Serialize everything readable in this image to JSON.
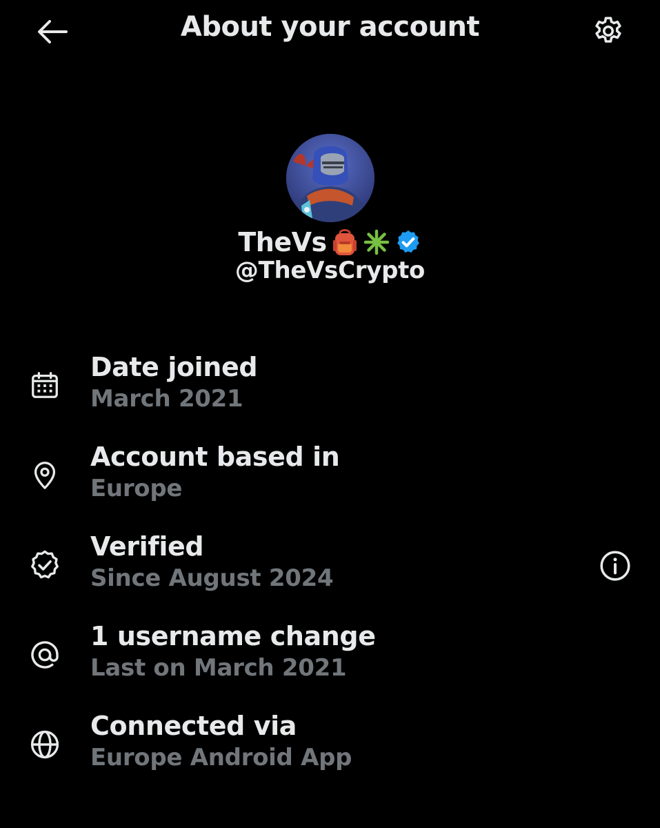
{
  "header": {
    "title": "About your account",
    "back_icon": "arrow-left-icon",
    "settings_icon": "gear-icon"
  },
  "profile": {
    "display_name": "TheVs",
    "name_emojis": [
      "🎒",
      "✳️"
    ],
    "verified_badge_color": "#1d9bf0",
    "handle": "@TheVsCrypto"
  },
  "info": [
    {
      "icon": "calendar-icon",
      "title": "Date joined",
      "subtitle": "March 2021"
    },
    {
      "icon": "location-pin-icon",
      "title": "Account based in",
      "subtitle": "Europe"
    },
    {
      "icon": "verified-badge-icon",
      "title": "Verified",
      "subtitle": "Since August 2024",
      "action_icon": "info-icon"
    },
    {
      "icon": "at-sign-icon",
      "title": "1 username change",
      "subtitle": "Last on March 2021"
    },
    {
      "icon": "globe-icon",
      "title": "Connected via",
      "subtitle": "Europe Android App"
    }
  ],
  "colors": {
    "background": "#000000",
    "primary_text": "#e7e9ea",
    "secondary_text": "#71767b",
    "accent": "#1d9bf0"
  }
}
